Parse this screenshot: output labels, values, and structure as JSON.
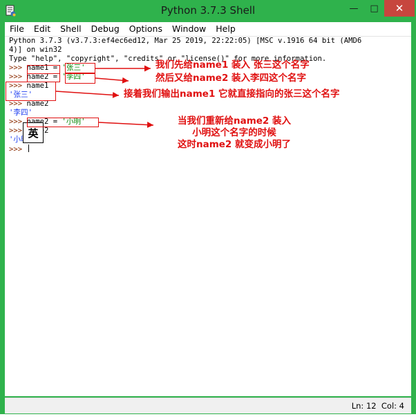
{
  "window": {
    "title": "Python 3.7.3 Shell",
    "controls": {
      "minimize": "—",
      "maximize": "□",
      "close": "✕"
    }
  },
  "menu": [
    "File",
    "Edit",
    "Shell",
    "Debug",
    "Options",
    "Window",
    "Help"
  ],
  "editor": {
    "banner_line1": "Python 3.7.3 (v3.7.3:ef4ec6ed12, Mar 25 2019, 22:22:05) [MSC v.1916 64 bit (AMD6",
    "banner_line2": "4)] on win32",
    "banner_line3_a": "Type \"help\", \"copyright\", \"credits\" or \"license()\" for more information.",
    "prompt": ">>> ",
    "line_name1_prefix": "name1 = ",
    "line_name1_str": "'张三'",
    "line_name2_prefix": "name2 = ",
    "line_name2_str": "'李四'",
    "line_echo_name1": "name1",
    "out_zhangsan": "'张三'",
    "line_echo_name2": "name2",
    "out_lisi": "'李四'",
    "line_name2b_prefix": "name2 = ",
    "line_name2b_str": "'小明'",
    "line_echo_name2b": "name2",
    "out_xiaoming": "'小明'",
    "ime_indicator": "英"
  },
  "annotations": {
    "note1": "我们先给name1 装入 张三这个名字",
    "note2": "然后又给name2 装入李四这个名字",
    "note3": "接着我们输出name1 它就直接指向的张三这个名字",
    "note4_line1": "当我们重新给name2 装入",
    "note4_line2": "小明这个名字的时候",
    "note4_line3": "这时name2 就变成小明了"
  },
  "status": {
    "line": "Ln: 12",
    "col": "Col: 4"
  },
  "colors": {
    "titlebar": "#2fb24c",
    "close_button": "#c7463e",
    "annotation_red": "#e01010",
    "prompt": "#8b2b00",
    "output_blue": "#1f3ff0",
    "string_green": "#0a8a0a"
  }
}
